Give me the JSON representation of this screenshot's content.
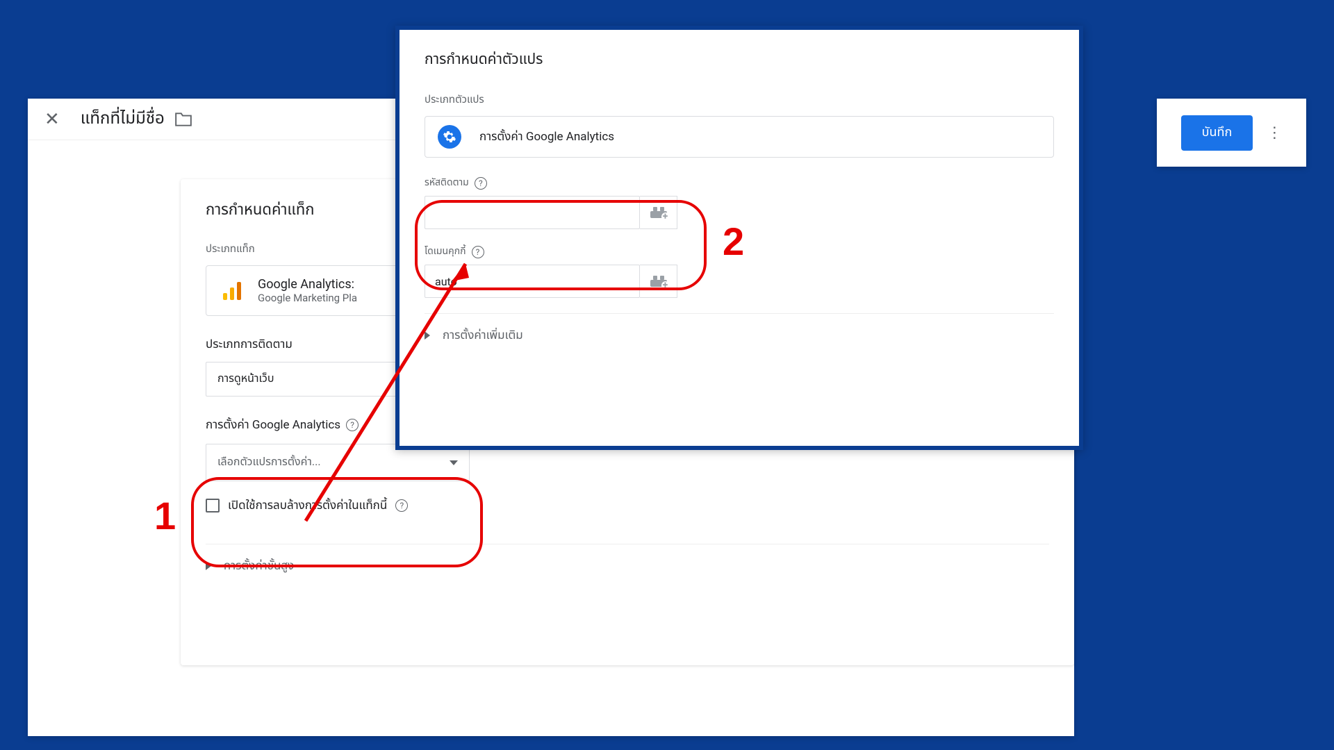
{
  "main": {
    "title": "แท็กที่ไม่มีชื่อ",
    "save_label": "บันทึก"
  },
  "tag": {
    "card_title": "การกำหนดค่าแท็ก",
    "type_label": "ประเภทแท็ก",
    "type_name": "Google Analytics:",
    "type_sub": "Google Marketing Pla",
    "tracking_heading": "ประเภทการติดตาม",
    "tracking_value": "การดูหน้าเว็บ",
    "ga_settings_heading": "การตั้งค่า Google Analytics",
    "select_placeholder": "เลือกตัวแปรการตั้งค่า...",
    "override_label": "เปิดใช้การลบล้างการตั้งค่าในแท็กนี้",
    "advanced": "การตั้งค่าขั้นสูง"
  },
  "variable": {
    "title": "การกำหนดค่าตัวแปร",
    "type_label": "ประเภทตัวแปร",
    "type_name": "การตั้งค่า Google Analytics",
    "tracking_id_label": "รหัสติดตาม",
    "tracking_id_value": "",
    "cookie_domain_label": "โดเมนคุกกี้",
    "cookie_domain_value": "auto",
    "advanced": "การตั้งค่าเพิ่มเติม"
  },
  "annotations": {
    "num1": "1",
    "num2": "2"
  }
}
